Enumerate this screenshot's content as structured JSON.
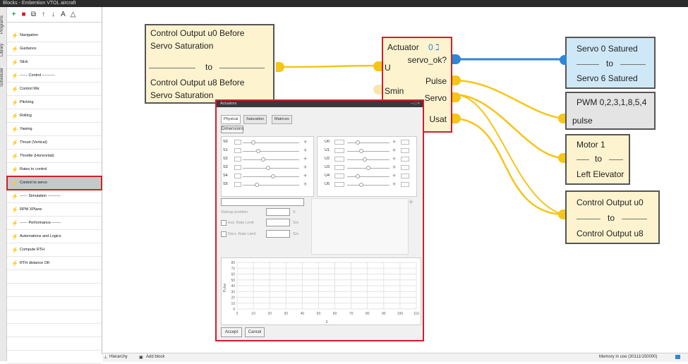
{
  "window": {
    "title": "Blocks - Embention VTOL aircraft"
  },
  "side_tabs": [
    "Programs",
    "Library",
    "Scheduler"
  ],
  "toolbar": {
    "icons": [
      "add-icon",
      "delete-icon",
      "copy-icon",
      "move-up-icon",
      "move-down-icon",
      "sort-alpha-icon",
      "sort-icon"
    ],
    "sort_label": "A"
  },
  "block_list": [
    "Navigation",
    "Guidance",
    "Stick",
    "------ Control ----------",
    "Control Mix",
    "Pitching",
    "Rolling",
    "Yawing",
    "Thrust (Vertical)",
    "Throttle (Horizontal)",
    "Rates to control",
    "Control to servo",
    "------ Simulation ----------",
    "RPM XPlane",
    "------ Performance -------",
    "Automations and Logics",
    "Compute RTH",
    "RTH distance OK"
  ],
  "selected_item": "Control to servo",
  "canvas": {
    "input_block": {
      "line1": "Control Output u0 Before",
      "line2": "Servo Saturation",
      "to": "to",
      "line3": "Control Output u8 Before",
      "line4": "Servo Saturation"
    },
    "actuator": {
      "title": "Actuator",
      "badge": "0",
      "ports_left": [
        "U",
        "Smin"
      ],
      "ports_right": [
        "servo_ok?",
        "Pulse",
        "Servo",
        "Usat"
      ]
    },
    "servo_block": {
      "line1": "Servo 0 Satured",
      "to": "to",
      "line2": "Servo 6 Satured"
    },
    "pwm_block": {
      "line1": "PWM 0,2,3,1,8,5,4",
      "line2": "pulse"
    },
    "motor_block": {
      "line1": "Motor 1",
      "to": "to",
      "line2": "Left Elevator"
    },
    "output_block": {
      "line1": "Control Output u0",
      "to": "to",
      "line2": "Control Output u8"
    }
  },
  "dialog": {
    "title": "Actuators",
    "controls": "– □ ×",
    "tabs": [
      "Physical",
      "Saturation",
      "Matrices"
    ],
    "active_tab": "Physical",
    "dimensions_button": "Dimensions",
    "servos": [
      "S0",
      "S1",
      "S2",
      "S3",
      "S4",
      "S5"
    ],
    "inputs": [
      "U0",
      "U1",
      "U2",
      "U3",
      "U4",
      "U5"
    ],
    "startup_position_label": "Startup position",
    "startup_unit": "S",
    "incr_rate_label": "Incr. Rate Limit",
    "decr_rate_label": "Decr. Rate Limit",
    "rate_unit": "S/s",
    "plot": {
      "yticks": [
        "80",
        "70",
        "60",
        "50",
        "40",
        "30",
        "20",
        "10",
        "0"
      ],
      "xticks": [
        "0",
        "10",
        "20",
        "30",
        "40",
        "50",
        "60",
        "70",
        "80",
        "90",
        "100",
        "110"
      ],
      "ylabel": "Pulse",
      "xlabel": "S"
    },
    "accept": "Accept",
    "cancel": "Cancel"
  },
  "bottom_bar": {
    "hierarchy": "Hierarchy",
    "add_block": "Add block",
    "memory": "Memory in use (30111/150000)"
  },
  "colors": {
    "block_fill": "#fdf3cf",
    "port": "#f5c518",
    "servo_fill": "#cfe8f7",
    "highlight": "#d01f2a",
    "wire_blue": "#2f86d8"
  }
}
